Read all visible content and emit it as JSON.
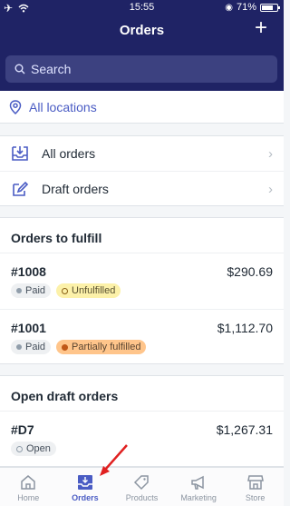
{
  "status": {
    "time": "15:55",
    "battery": "71%"
  },
  "header": {
    "title": "Orders",
    "add_label": "+"
  },
  "search": {
    "placeholder": "Search"
  },
  "location": {
    "label": "All locations"
  },
  "nav": {
    "all_orders": "All orders",
    "draft_orders": "Draft orders",
    "chevron": "›"
  },
  "fulfill": {
    "title": "Orders to fulfill",
    "orders": [
      {
        "id": "#1008",
        "amount": "$290.69",
        "payment": "Paid",
        "fulfillment": "Unfulfilled"
      },
      {
        "id": "#1001",
        "amount": "$1,112.70",
        "payment": "Paid",
        "fulfillment": "Partially fulfilled"
      }
    ]
  },
  "drafts": {
    "title": "Open draft orders",
    "orders": [
      {
        "id": "#D7",
        "amount": "$1,267.31",
        "status": "Open"
      }
    ]
  },
  "tabs": [
    {
      "label": "Home",
      "icon": "home-icon"
    },
    {
      "label": "Orders",
      "icon": "orders-icon",
      "active": true
    },
    {
      "label": "Products",
      "icon": "tag-icon"
    },
    {
      "label": "Marketing",
      "icon": "megaphone-icon"
    },
    {
      "label": "Store",
      "icon": "store-icon"
    }
  ],
  "colors": {
    "header_bg": "#1f2365",
    "accent": "#4a5cc4",
    "arrow": "#e02020"
  }
}
